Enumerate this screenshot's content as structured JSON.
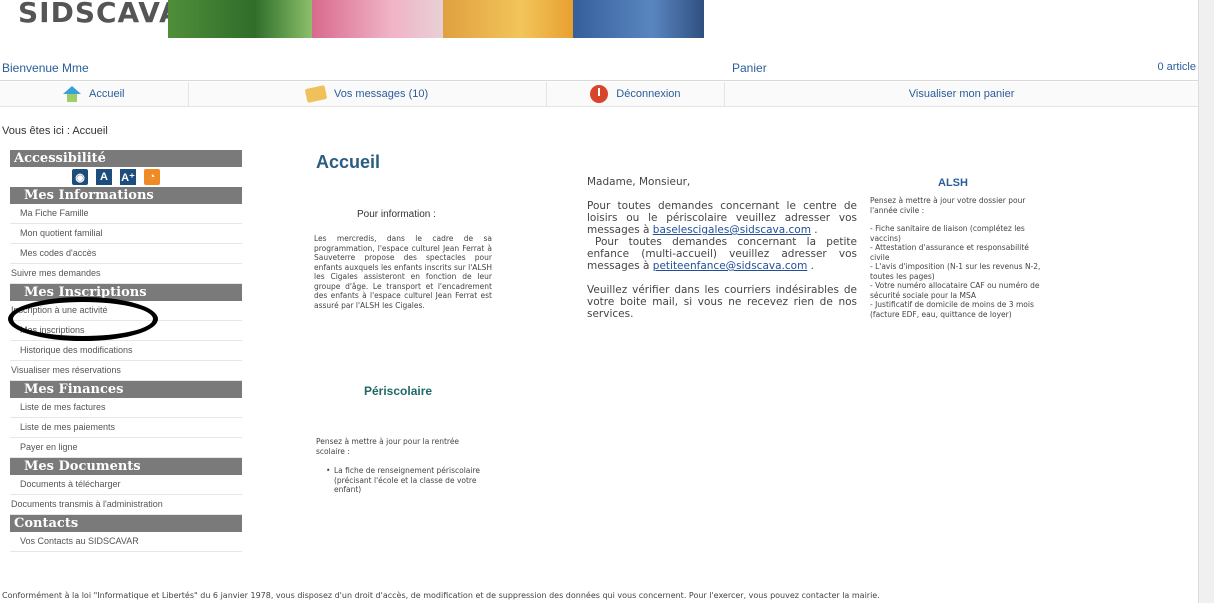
{
  "header": {
    "logo_text": "SIDSCAVAR"
  },
  "welcome": {
    "greeting": "Bienvenue Mme",
    "cart_label": "Panier",
    "cart_count": "0 article"
  },
  "nav": {
    "home": "Accueil",
    "messages": "Vos messages (10)",
    "logout": "Déconnexion",
    "view_cart": "Visualiser mon panier"
  },
  "breadcrumb": "Vous êtes ici : Accueil",
  "sidebar": {
    "accessibility_title": "Accessibilité",
    "accessibility_icons": [
      "eye-icon",
      "text-size-a-icon",
      "text-size-a-plus-icon",
      "rss-icon"
    ],
    "sections": [
      {
        "title": "Mes Informations",
        "items": [
          "Ma Fiche Famille",
          "Mon quotient familial",
          "Mes codes d'accès",
          "Suivre mes demandes"
        ]
      },
      {
        "title": "Mes Inscriptions",
        "items": [
          "Inscription à une activité",
          "Mes inscriptions",
          "Historique des modifications",
          "Visualiser mes réservations"
        ]
      },
      {
        "title": "Mes Finances",
        "items": [
          "Liste de mes factures",
          "Liste de mes paiements",
          "Payer en ligne"
        ]
      },
      {
        "title": "Mes Documents",
        "items": [
          "Documents à télécharger",
          "Documents transmis à l'administration"
        ]
      },
      {
        "title": "Contacts",
        "items": [
          "Vos Contacts au SIDSCAVAR"
        ]
      }
    ]
  },
  "main": {
    "title": "Accueil",
    "info_title": "Pour information :",
    "info_text": "Les mercredis, dans le cadre de sa programmation, l'espace culturel Jean Ferrat à Sauveterre propose des spectacles pour enfants auxquels les enfants inscrits sur l'ALSH les Cigales assisteront en fonction de leur groupe d'âge. Le transport et l'encadrement des enfants à l'espace culturel Jean Ferrat est assuré par l'ALSH les Cigales.",
    "periscolaire_title": "Périscolaire",
    "periscolaire_intro": "Pensez à mettre à jour pour la rentrée scolaire :",
    "periscolaire_item": "La fiche de renseignement périscolaire (précisant l'école et la classe de votre enfant)"
  },
  "message": {
    "greeting": "Madame, Monsieur,",
    "p1": "Pour toutes demandes concernant le centre de loisirs ou le périscolaire veuillez adresser vos messages à",
    "email1": "baselescigales@sidscava.com",
    "p1_end": " .",
    "p2": "Pour toutes demandes concernant la petite enfance (multi-accueil) veuillez adresser vos messages à",
    "email2": "petiteenfance@sidscava.com",
    "p2_end": " .",
    "p3": "Veuillez vérifier dans les courriers indésirables de votre boite mail, si vous ne recevez rien de nos services."
  },
  "alsh": {
    "title": "ALSH",
    "intro": "Pensez à mettre à jour votre dossier pour l'année civile :",
    "items": [
      "- Fiche sanitaire de liaison (complétez les vaccins)",
      "- Attestation d'assurance et responsabilité civile",
      "- L'avis d'imposition (N-1 sur les revenus N-2, toutes les pages)",
      "- Votre numéro allocataire CAF ou numéro de sécurité sociale pour la MSA",
      "- Justificatif de domicile de moins de 3 mois (facture EDF, eau, quittance de loyer)"
    ]
  },
  "footer": "Conformément à la loi \"Informatique et Libertés\" du 6 janvier 1978, vous disposez d'un droit d'accès, de modification et de suppression des données qui vous concernent. Pour l'exercer, vous pouvez contacter la mairie."
}
